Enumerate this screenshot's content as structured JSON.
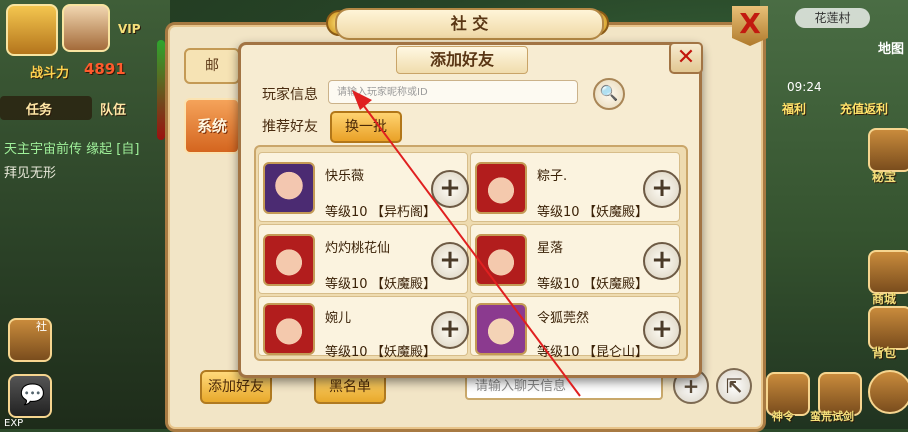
{
  "hud": {
    "vip_label": "VIP",
    "power_label": "战斗力",
    "power_value": "4891",
    "task_tab": "任务",
    "team_tab": "队伍",
    "chat_line1": "天主宇宙前传 缘起 [自]",
    "chat_line2": "拜见无形",
    "fragment_label": "社",
    "exp_label": "EXP"
  },
  "right_hud": {
    "village_label": "花莲村",
    "map_label": "地图",
    "time": "09:24",
    "welfare": "福利",
    "recharge": "充值返利",
    "treasure": "秘宝",
    "shop": "商城",
    "bag": "背包",
    "trial": "蛮荒试剑",
    "order": "神令"
  },
  "social": {
    "title": "社 交",
    "close_icon": "close-x-icon",
    "mail_tab": "邮",
    "system_btn": "系统",
    "add_friend_btn": "添加好友",
    "blacklist_btn": "黑名单",
    "chat_placeholder": "请输入聊天信息"
  },
  "dialog": {
    "title": "添加好友",
    "player_info_label": "玩家信息",
    "search_placeholder": "请输入玩家昵称或ID",
    "recommend_label": "推荐好友",
    "refresh_btn": "换一批",
    "friends": [
      {
        "name": "快乐薇",
        "level": "等级10",
        "faction": "【异朽阁】"
      },
      {
        "name": "粽子.",
        "level": "等级10",
        "faction": "【妖魔殿】"
      },
      {
        "name": "灼灼桃花仙",
        "level": "等级10",
        "faction": "【妖魔殿】"
      },
      {
        "name": "星落",
        "level": "等级10",
        "faction": "【妖魔殿】"
      },
      {
        "name": "婉儿",
        "level": "等级10",
        "faction": "【妖魔殿】"
      },
      {
        "name": "令狐莞然",
        "level": "等级10",
        "faction": "【昆仑山】"
      }
    ]
  },
  "colors": {
    "panel_bg": "#f2e5c6",
    "accent_gold": "#e9a127",
    "close_red": "#c2140c",
    "arrow_red": "#e02020"
  }
}
